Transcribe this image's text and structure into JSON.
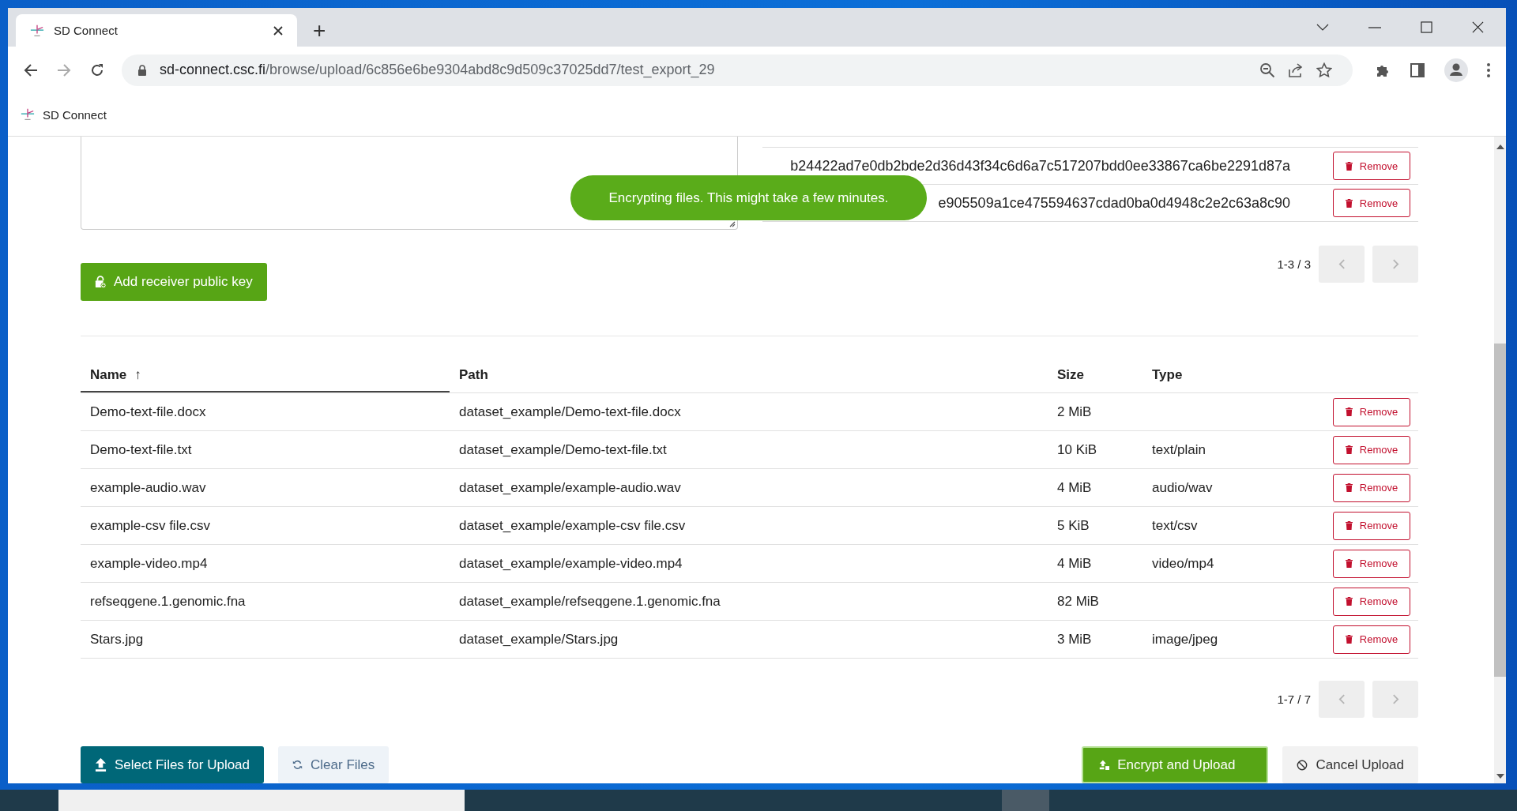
{
  "browser": {
    "tab": {
      "title": "SD Connect"
    },
    "new_tab": "+",
    "url": {
      "host": "sd-connect.csc.fi",
      "path": "/browse/upload/6c856e6be9304abd8c9d509c37025dd7/test_export_29"
    },
    "bookmark": "SD Connect"
  },
  "receiver_keys": {
    "keys": [
      {
        "text": "b24422ad7e0db2bde2d36d43f34c6d6a7c517207bdd0ee33867ca6be2291d87a",
        "action": "Remove"
      },
      {
        "text": "e905509a1ce475594637cdad0ba0d4948c2e2c63a8c90",
        "action": "Remove"
      }
    ],
    "pagination": "1-3 / 3",
    "add_button": "Add receiver public key"
  },
  "toast": "Encrypting files. This might take a few minutes.",
  "files": {
    "columns": [
      {
        "label": "Name",
        "sort": "↑",
        "sorted": true
      },
      {
        "label": "Path",
        "sorted": false
      },
      {
        "label": "Size",
        "sorted": false
      },
      {
        "label": "Type",
        "sorted": false
      }
    ],
    "rows": [
      {
        "name": "Demo-text-file.docx",
        "path": "dataset_example/Demo-text-file.docx",
        "size": "2 MiB",
        "action": "Remove"
      },
      {
        "name": "Demo-text-file.txt",
        "path": "dataset_example/Demo-text-file.txt",
        "size": "10 KiB",
        "type": "text/plain",
        "action": "Remove"
      },
      {
        "name": "example-audio.wav",
        "path": "dataset_example/example-audio.wav",
        "size": "4 MiB",
        "type": "audio/wav",
        "action": "Remove"
      },
      {
        "name": "example-csv file.csv",
        "path": "dataset_example/example-csv file.csv",
        "size": "5 KiB",
        "type": "text/csv",
        "action": "Remove"
      },
      {
        "name": "example-video.mp4",
        "path": "dataset_example/example-video.mp4",
        "size": "4 MiB",
        "type": "video/mp4",
        "action": "Remove"
      },
      {
        "name": "refseqgene.1.genomic.fna",
        "path": "dataset_example/refseqgene.1.genomic.fna",
        "size": "82 MiB",
        "action": "Remove"
      },
      {
        "name": "Stars.jpg",
        "path": "dataset_example/Stars.jpg",
        "size": "3 MiB",
        "type": "image/jpeg",
        "action": "Remove"
      }
    ],
    "pagination": "1-7 / 7"
  },
  "actions": {
    "select": "Select Files for Upload",
    "clear": "Clear Files",
    "encrypt": "Encrypt and Upload",
    "cancel": "Cancel Upload"
  }
}
